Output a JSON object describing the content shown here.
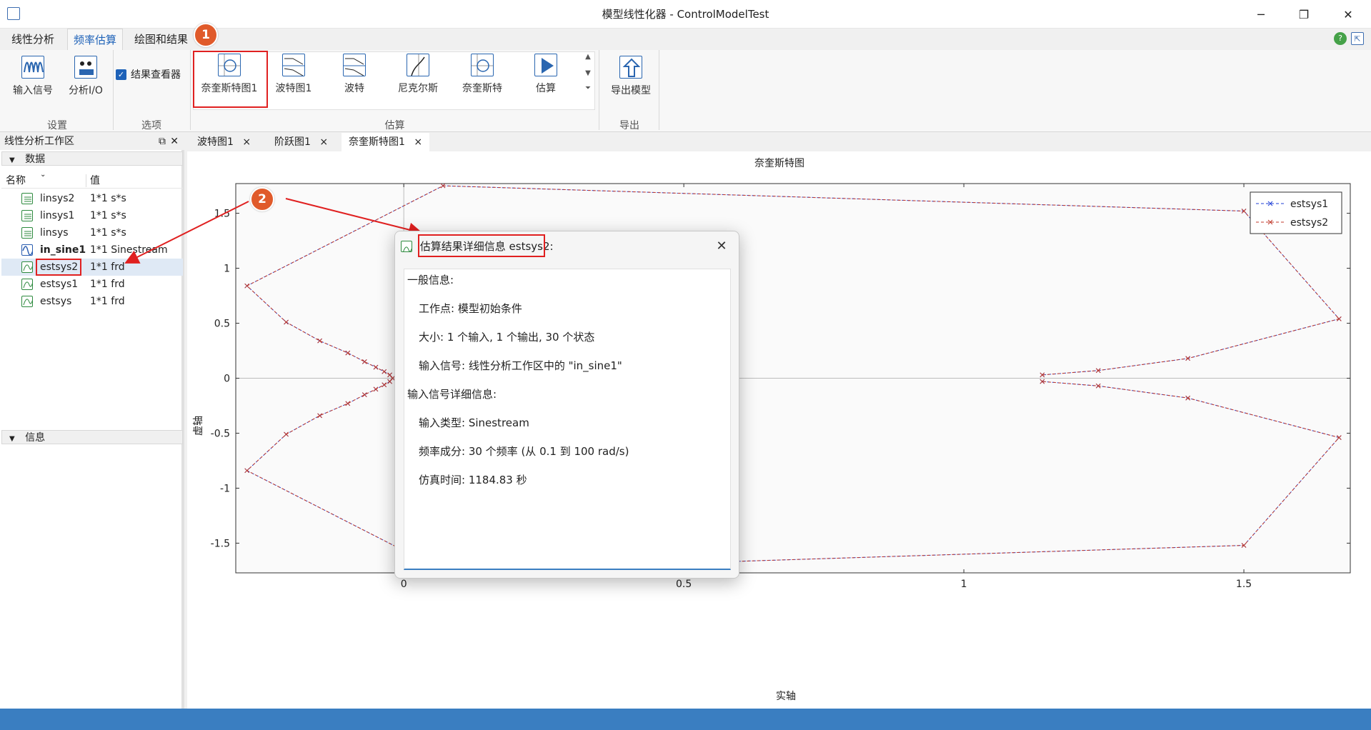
{
  "window": {
    "title": "模型线性化器 - ControlModelTest",
    "minimize": "─",
    "maximize": "❐",
    "close": "✕"
  },
  "ribbon_tabs": [
    "线性分析",
    "频率估算",
    "绘图和结果"
  ],
  "ribbon": {
    "setup": {
      "input_signal": "输入信号",
      "analysis_io": "分析I/O",
      "label": "设置"
    },
    "options": {
      "result_viewer": "结果查看器",
      "label": "选项"
    },
    "estimate": {
      "gallery": [
        "奈奎斯特图1",
        "波特图1",
        "波特",
        "尼克尔斯",
        "奈奎斯特",
        "估算"
      ],
      "label": "估算"
    },
    "export": {
      "export_model": "导出模型",
      "label": "导出"
    }
  },
  "annotations": {
    "badge1": "1",
    "badge2": "2"
  },
  "workspace": {
    "title": "线性分析工作区",
    "data_section": "数据",
    "info_section": "信息",
    "col_name": "名称",
    "col_value": "值",
    "rows": [
      {
        "name": "linsys2",
        "value": "1*1 s*s"
      },
      {
        "name": "linsys1",
        "value": "1*1 s*s"
      },
      {
        "name": "linsys",
        "value": "1*1 s*s"
      },
      {
        "name": "in_sine1",
        "value": "1*1 Sinestream"
      },
      {
        "name": "estsys2",
        "value": "1*1 frd"
      },
      {
        "name": "estsys1",
        "value": "1*1 frd"
      },
      {
        "name": "estsys",
        "value": "1*1 frd"
      }
    ]
  },
  "doc_tabs": [
    "波特图1",
    "阶跃图1",
    "奈奎斯特图1"
  ],
  "tab_close": "×",
  "dialog": {
    "title_highlight": "估算结果详细信息 estsys2",
    "title_suffix": ":",
    "close": "✕",
    "lines": [
      "一般信息:",
      "工作点:  模型初始条件",
      "大小:  1 个输入,  1 个输出,  30 个状态",
      "输入信号: 线性分析工作区中的 \"in_sine1\"",
      "输入信号详细信息:",
      "输入类型:  Sinestream",
      "频率成分:  30 个频率 (从 0.1 到 100 rad/s)",
      "仿真时间:  1184.83 秒"
    ]
  },
  "chart_data": {
    "type": "line",
    "title": "奈奎斯特图",
    "xlabel": "实轴",
    "ylabel": "虚轴",
    "xlim": [
      -0.3,
      1.69
    ],
    "ylim": [
      -1.77,
      1.77
    ],
    "xticks": [
      0,
      0.5,
      1,
      1.5
    ],
    "yticks": [
      -1.5,
      -1,
      -0.5,
      0,
      0.5,
      1,
      1.5
    ],
    "legend_position": "top-right",
    "series": [
      {
        "name": "estsys1",
        "color": "#1f3fd6",
        "x": [
          1.14,
          1.24,
          1.4,
          1.67,
          1.5,
          0.07,
          -0.28,
          -0.21,
          -0.15,
          -0.1,
          -0.07,
          -0.05,
          -0.035,
          -0.025,
          -0.02,
          -0.025,
          -0.035,
          -0.05,
          -0.07,
          -0.1,
          -0.15,
          -0.21,
          -0.28,
          0.07,
          1.5,
          1.67,
          1.4,
          1.24,
          1.14
        ],
        "y": [
          -0.03,
          -0.07,
          -0.18,
          -0.54,
          -1.52,
          -1.75,
          -0.84,
          -0.51,
          -0.34,
          -0.23,
          -0.15,
          -0.1,
          -0.06,
          -0.03,
          0.0,
          0.03,
          0.06,
          0.1,
          0.15,
          0.23,
          0.34,
          0.51,
          0.84,
          1.75,
          1.52,
          0.54,
          0.18,
          0.07,
          0.03
        ]
      },
      {
        "name": "estsys2",
        "color": "#c0392b",
        "x": [
          1.14,
          1.24,
          1.4,
          1.67,
          1.5,
          0.07,
          -0.28,
          -0.21,
          -0.15,
          -0.1,
          -0.07,
          -0.05,
          -0.035,
          -0.025,
          -0.02,
          -0.025,
          -0.035,
          -0.05,
          -0.07,
          -0.1,
          -0.15,
          -0.21,
          -0.28,
          0.07,
          1.5,
          1.67,
          1.4,
          1.24,
          1.14
        ],
        "y": [
          0.03,
          0.07,
          0.18,
          0.54,
          1.52,
          1.75,
          0.84,
          0.51,
          0.34,
          0.23,
          0.15,
          0.1,
          0.06,
          0.03,
          0.0,
          -0.03,
          -0.06,
          -0.1,
          -0.15,
          -0.23,
          -0.34,
          -0.51,
          -0.84,
          -1.75,
          -1.52,
          -0.54,
          -0.18,
          -0.07,
          -0.03
        ]
      }
    ]
  },
  "colors": {
    "accent": "#1e62b8",
    "highlight": "#e02020",
    "badge": "#e05a2a",
    "statusbar": "#3a7ec1"
  }
}
